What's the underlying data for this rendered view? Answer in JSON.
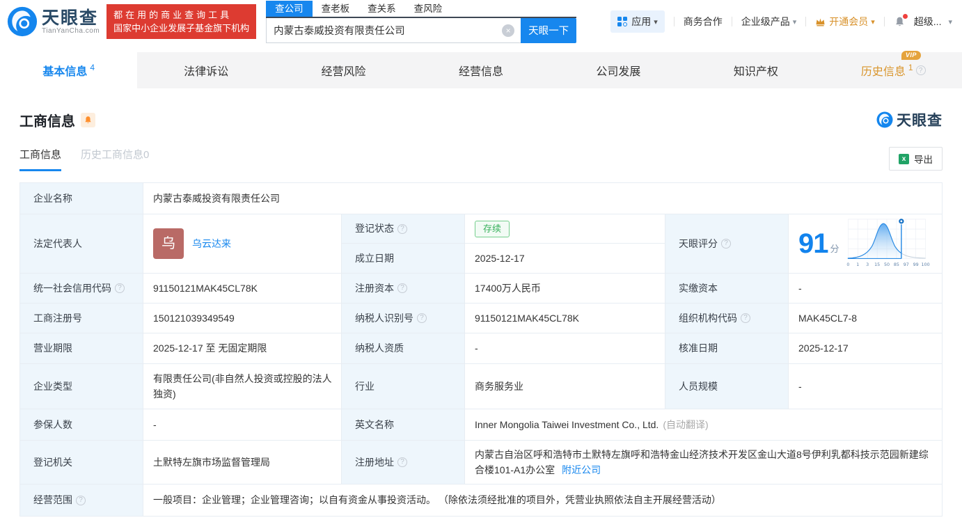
{
  "header": {
    "logo": {
      "title": "天眼查",
      "subtitle": "TianYanCha.com"
    },
    "promo": {
      "line1": "都在用的商业查询工具",
      "line2": "国家中小企业发展子基金旗下机构"
    },
    "search": {
      "tabs": [
        "查公司",
        "查老板",
        "查关系",
        "查风险"
      ],
      "value": "内蒙古泰威投资有限责任公司",
      "button": "天眼一下"
    },
    "nav": {
      "apps": "应用",
      "cooperation": "商务合作",
      "enterprise": "企业级产品",
      "vip": "开通会员",
      "user": "超级..."
    }
  },
  "icons": {
    "caret_down": "▾",
    "clear": "×",
    "help": "?",
    "excel": "x"
  },
  "main_tabs": {
    "basic": {
      "label": "基本信息",
      "count": "4"
    },
    "legal": {
      "label": "法律诉讼"
    },
    "risk": {
      "label": "经营风险"
    },
    "operation": {
      "label": "经营信息"
    },
    "development": {
      "label": "公司发展"
    },
    "ip": {
      "label": "知识产权"
    },
    "history": {
      "label": "历史信息",
      "count": "1",
      "badge": "VIP"
    }
  },
  "section": {
    "title": "工商信息",
    "watermark": "天眼查",
    "subtab_active": "工商信息",
    "subtab_history": "历史工商信息",
    "subtab_history_count": "0",
    "export_label": "导出"
  },
  "fields": {
    "company_name_label": "企业名称",
    "company_name": "内蒙古泰威投资有限责任公司",
    "legal_rep_label": "法定代表人",
    "legal_rep_avatar": "乌",
    "legal_rep_name": "乌云达来",
    "reg_status_label": "登记状态",
    "reg_status": "存续",
    "establish_date_label": "成立日期",
    "establish_date": "2025-12-17",
    "score_label": "天眼评分",
    "score": "91",
    "score_unit": "分",
    "credit_code_label": "统一社会信用代码",
    "credit_code": "91150121MAK45CL78K",
    "reg_capital_label": "注册资本",
    "reg_capital": "17400万人民币",
    "paid_capital_label": "实缴资本",
    "paid_capital": "-",
    "reg_number_label": "工商注册号",
    "reg_number": "150121039349549",
    "taxpayer_id_label": "纳税人识别号",
    "taxpayer_id": "91150121MAK45CL78K",
    "org_code_label": "组织机构代码",
    "org_code": "MAK45CL7-8",
    "term_label": "营业期限",
    "term": "2025-12-17 至 无固定期限",
    "taxpayer_quality_label": "纳税人资质",
    "taxpayer_quality": "-",
    "approval_date_label": "核准日期",
    "approval_date": "2025-12-17",
    "company_type_label": "企业类型",
    "company_type": "有限责任公司(非自然人投资或控股的法人独资)",
    "industry_label": "行业",
    "industry": "商务服务业",
    "staff_label": "人员规模",
    "staff": "-",
    "insured_label": "参保人数",
    "insured": "-",
    "en_name_label": "英文名称",
    "en_name": "Inner Mongolia Taiwei Investment Co., Ltd.",
    "en_name_note": "(自动翻译)",
    "authority_label": "登记机关",
    "authority": "土默特左旗市场监督管理局",
    "address_label": "注册地址",
    "address": "内蒙古自治区呼和浩特市土默特左旗呼和浩特金山经济技术开发区金山大道8号伊利乳都科技示范园新建综合楼101-A1办公室",
    "nearby": "附近公司",
    "scope_label": "经营范围",
    "scope": "一般项目：企业管理；企业管理咨询；以自有资金从事投资活动。 （除依法须经批准的项目外，凭营业执照依法自主开展经营活动）"
  },
  "chart_data": {
    "type": "area",
    "title": "天眼评分分布曲线",
    "score": 91,
    "marker_value": 91,
    "x_ticks": [
      "0",
      "1",
      "3",
      "15",
      "50",
      "85",
      "97",
      "99",
      "100"
    ],
    "curve_peak_near_tick": "50",
    "legend_position": "none",
    "grid": true
  },
  "colors": {
    "brand_blue": "#1787ee",
    "promo_red": "#dd3b31",
    "label_cell_bg": "#eef6fc",
    "status_green": "#38b15c",
    "vip_orange": "#d9952c",
    "score_blue": "#1283ed"
  }
}
